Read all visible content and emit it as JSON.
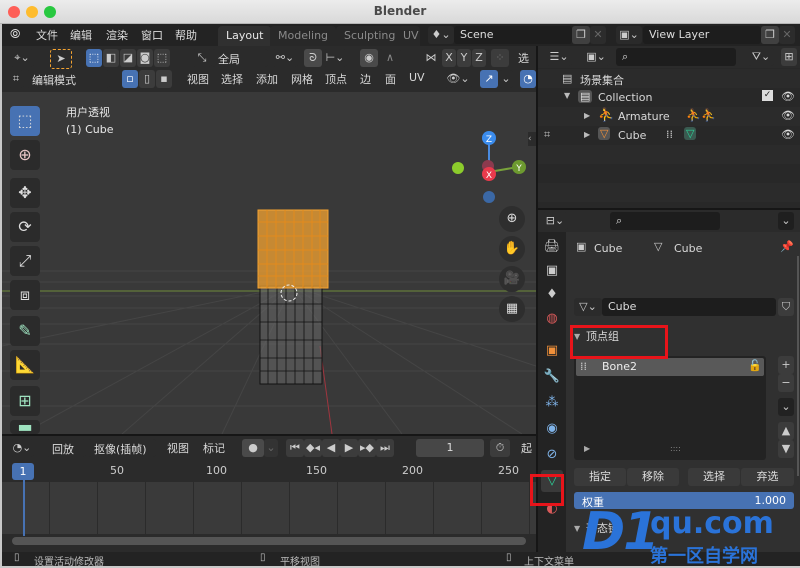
{
  "window": {
    "title": "Blender"
  },
  "menu": [
    "文件",
    "编辑",
    "渲染",
    "窗口",
    "帮助"
  ],
  "workspace_tabs": [
    {
      "label": "Layout",
      "active": true
    },
    {
      "label": "Modeling",
      "active": false
    },
    {
      "label": "Sculpting",
      "active": false
    },
    {
      "label": "UV",
      "active": false
    }
  ],
  "scene": {
    "label": "Scene",
    "icon": "scene-icon"
  },
  "view_layer": {
    "label": "View Layer",
    "icon": "view-layer-icon"
  },
  "viewport_header": {
    "transform_orientation": "全局",
    "mode": "编辑模式",
    "axes": [
      "X",
      "Y",
      "Z"
    ],
    "options_label": "选项",
    "menus": [
      "视图",
      "选择",
      "添加",
      "网格",
      "顶点",
      "边",
      "面",
      "UV"
    ]
  },
  "viewport": {
    "view_name": "用户透视",
    "object_info": "(1) Cube",
    "gizmo": {
      "z": "Z",
      "x": "X",
      "y": "Y"
    }
  },
  "outliner": {
    "search_placeholder": "",
    "root": "场景集合",
    "items": [
      {
        "label": "Collection",
        "level": 1,
        "checked": true,
        "visible": true
      },
      {
        "label": "Armature",
        "level": 2,
        "visible": true
      },
      {
        "label": "Cube",
        "level": 2,
        "visible": true
      }
    ]
  },
  "properties": {
    "search_placeholder": "",
    "breadcrumb": {
      "object": "Cube",
      "data": "Cube"
    },
    "mesh_name": "Cube",
    "vertex_groups": {
      "title": "顶点组",
      "items": [
        {
          "label": "Bone2",
          "selected": true
        }
      ]
    },
    "buttons": {
      "assign": "指定",
      "remove": "移除",
      "select": "选择",
      "deselect": "弃选"
    },
    "weight": {
      "label": "权重",
      "value": "1.000"
    },
    "shape_keys": {
      "title": "形态键"
    }
  },
  "timeline": {
    "menus": {
      "playback": "回放",
      "keying": "抠像(插帧)",
      "view": "视图",
      "marker": "标记"
    },
    "current_frame": "1",
    "start_label": "起",
    "ruler": [
      "1",
      "50",
      "100",
      "150",
      "200",
      "250"
    ]
  },
  "statusbar": {
    "left": "设置活动修改器",
    "middle": "平移视图",
    "right": "上下文菜单"
  },
  "watermark": {
    "brand": "D1qu.com",
    "sub": "第一区自学网"
  },
  "colors": {
    "accent": "#4772b3",
    "highlight": "#e8141a",
    "selection_orange": "#f5a431",
    "data_green": "#2cd399"
  }
}
